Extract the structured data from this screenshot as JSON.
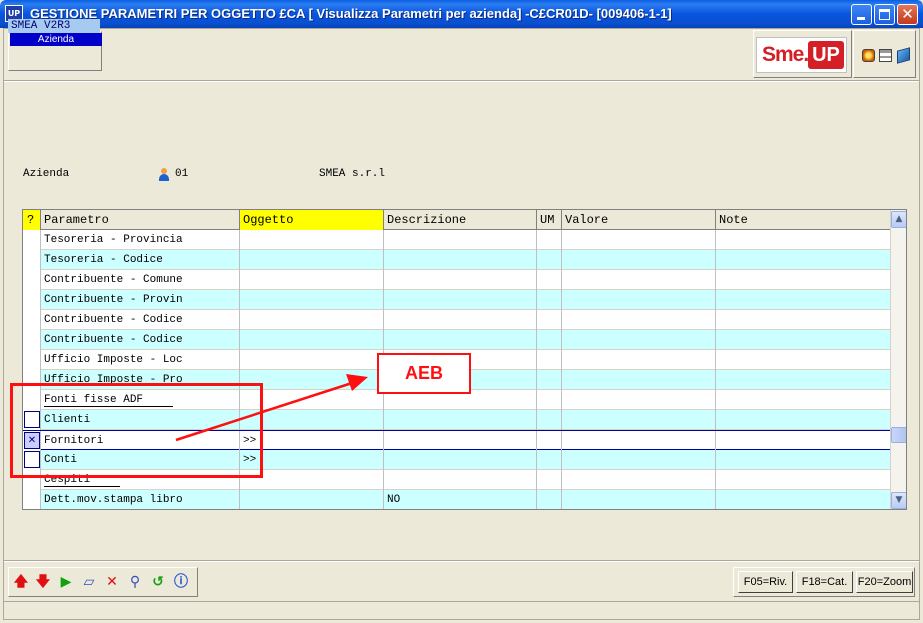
{
  "window": {
    "title": "GESTIONE PARAMETRI PER OGGETTO £CA [ Visualizza Parametri per azienda] -C£CR01D- [009406-1-1]",
    "app_icon_text": "UP"
  },
  "header": {
    "azienda_label": "Azienda",
    "azienda_value": "SMEA V2R3",
    "logo_text_left": "Sme.",
    "logo_text_right": "UP"
  },
  "context": {
    "label": "Azienda",
    "code": "01",
    "name": "SMEA s.r.l"
  },
  "grid": {
    "columns": [
      "?",
      "Parametro",
      "Oggetto",
      "Descrizione",
      "UM",
      "Valore",
      "Note"
    ],
    "rows": [
      {
        "parametro": "Tesoreria - Provincia",
        "oggetto": "",
        "descrizione": "",
        "check": "none",
        "underline": false
      },
      {
        "parametro": "Tesoreria - Codice",
        "oggetto": "",
        "descrizione": "",
        "check": "none",
        "underline": false
      },
      {
        "parametro": "Contribuente - Comune",
        "oggetto": "",
        "descrizione": "",
        "check": "none",
        "underline": false
      },
      {
        "parametro": "Contribuente - Provin",
        "oggetto": "",
        "descrizione": "",
        "check": "none",
        "underline": false
      },
      {
        "parametro": "Contribuente - Codice",
        "oggetto": "",
        "descrizione": "",
        "check": "none",
        "underline": false
      },
      {
        "parametro": "Contribuente - Codice",
        "oggetto": "",
        "descrizione": "",
        "check": "none",
        "underline": false
      },
      {
        "parametro": "Ufficio Imposte - Loc",
        "oggetto": "",
        "descrizione": "",
        "check": "none",
        "underline": false
      },
      {
        "parametro": "Ufficio Imposte - Pro",
        "oggetto": "",
        "descrizione": "",
        "check": "none",
        "underline": false
      },
      {
        "parametro": "Fonti fisse ADF",
        "oggetto": "",
        "descrizione": "",
        "check": "none",
        "underline": true
      },
      {
        "parametro": "Clienti",
        "oggetto": "",
        "descrizione": "",
        "check": "empty",
        "underline": false
      },
      {
        "parametro": "Fornitori",
        "oggetto": ">>",
        "descrizione": "",
        "check": "x",
        "underline": false
      },
      {
        "parametro": "Conti",
        "oggetto": ">>",
        "descrizione": "",
        "check": "empty",
        "underline": false
      },
      {
        "parametro": "Cespiti",
        "oggetto": "",
        "descrizione": "",
        "check": "none",
        "underline": true
      },
      {
        "parametro": "Dett.mov.stampa libro",
        "oggetto": "",
        "descrizione": "NO",
        "check": "none",
        "underline": false
      }
    ],
    "header_highlight_color": "#ffff00",
    "alt_row_color": "#ccffff"
  },
  "annotation": {
    "label": "AEB",
    "color": "#ff1010"
  },
  "toolbar": {
    "icons": [
      "arrow-up-icon",
      "arrow-down-icon",
      "play-icon",
      "eraser-icon",
      "delete-icon",
      "search-icon",
      "refresh-icon",
      "info-icon"
    ],
    "f05": "F05=Riv.",
    "f18": "F18=Cat.",
    "f20": "F20=Zoom"
  }
}
